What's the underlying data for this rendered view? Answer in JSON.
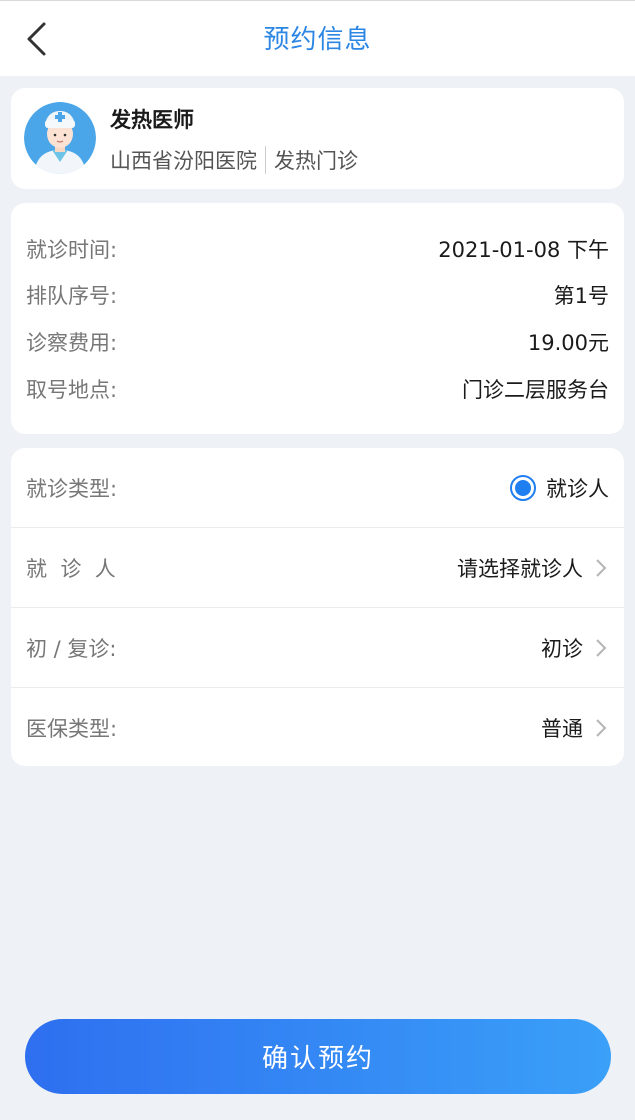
{
  "header": {
    "title": "预约信息",
    "back_icon": "chevron-left-icon"
  },
  "doctor": {
    "name": "发热医师",
    "hospital": "山西省汾阳医院",
    "department": "发热门诊",
    "avatar_icon": "doctor-avatar-icon"
  },
  "appointment": {
    "rows": [
      {
        "label": "就诊时间:",
        "value": "2021-01-08 下午"
      },
      {
        "label": "排队序号:",
        "value": "第1号"
      },
      {
        "label": "诊察费用:",
        "value": "19.00元"
      },
      {
        "label": "取号地点:",
        "value": "门诊二层服务台"
      }
    ]
  },
  "form": {
    "visit_type": {
      "label": "就诊类型:",
      "value": "就诊人",
      "selected": true
    },
    "patient": {
      "label": "就  诊  人",
      "value": "请选择就诊人"
    },
    "visit_kind": {
      "label": "初 / 复诊:",
      "value": "初诊"
    },
    "insurance": {
      "label": "医保类型:",
      "value": "普通"
    }
  },
  "confirm_button": {
    "label": "确认预约"
  },
  "colors": {
    "accent": "#2b86e4",
    "background": "#eef1f5",
    "button_gradient_start": "#2e6ff0",
    "button_gradient_end": "#3aa0f8"
  }
}
